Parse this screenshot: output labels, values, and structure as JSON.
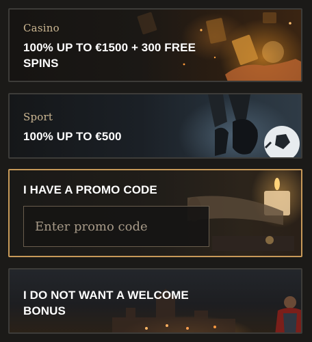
{
  "cards": {
    "casino": {
      "subtitle": "Casino",
      "title": "100% UP TO €1500 + 300 FREE SPINS"
    },
    "sport": {
      "subtitle": "Sport",
      "title": "100% UP TO €500"
    },
    "promo": {
      "title": "I HAVE A PROMO CODE",
      "input_placeholder": "Enter promo code",
      "input_value": ""
    },
    "no_bonus": {
      "title": "I DO NOT WANT A WELCOME BONUS"
    }
  },
  "colors": {
    "page_background": "#1b1a18",
    "card_border": "#3d3c39",
    "selected_border": "#c89a59",
    "subtitle_gold": "#cdb893",
    "title_white": "#ffffff"
  },
  "icons": {
    "casino_art": "hand-with-glowing-cards",
    "sport_art": "boot-kicking-football",
    "promo_art": "candle-and-scroll",
    "no_bonus_art": "knight-over-city"
  }
}
